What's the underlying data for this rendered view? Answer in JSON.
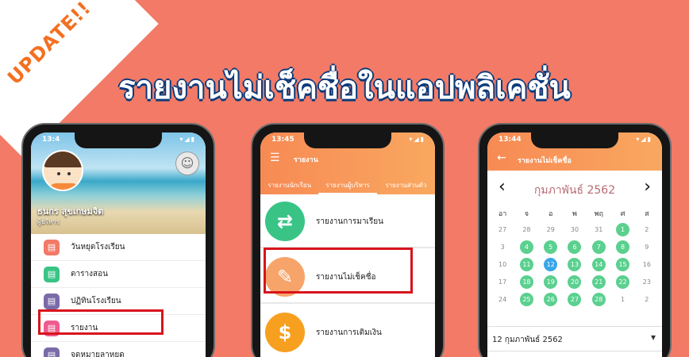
{
  "badge": "UPDATE!!",
  "headline": "รายงานไม่เช็คชื่อในแอปพลิเคชั่น",
  "phone1": {
    "time": "13:4",
    "user_name": "ธนกร สุขเกษมจิต",
    "user_role": "ผู้บริหาร",
    "menu": [
      {
        "label": "วันหยุดโรงเรียน",
        "color": "#f27a66",
        "icon": "calendar-icon"
      },
      {
        "label": "ตารางสอน",
        "color": "#39c486",
        "icon": "schedule-icon"
      },
      {
        "label": "ปฏิทินโรงเรียน",
        "color": "#7a6aa8",
        "icon": "calendar-icon"
      },
      {
        "label": "รายงาน",
        "color": "#ef5b8f",
        "icon": "chart-icon"
      },
      {
        "label": "จดหมายลาหยุด",
        "color": "#7a6aa8",
        "icon": "letter-icon"
      }
    ]
  },
  "phone2": {
    "time": "13:45",
    "title": "รายงาน",
    "tabs": [
      "รายงานนักเรียน",
      "รายงานผู้บริหาร",
      "รายงานส่วนตัว"
    ],
    "active_tab": 1,
    "rows": [
      {
        "label": "รายงานการมาเรียน",
        "color": "#39c486",
        "glyph": "⇄",
        "icon": "exchange-icon"
      },
      {
        "label": "รายงานไม่เช็คชื่อ",
        "color": "#f7a46a",
        "glyph": "✎",
        "icon": "pencil-icon"
      },
      {
        "label": "รายงานการเติมเงิน",
        "color": "#f7a020",
        "glyph": "$",
        "icon": "dollar-icon"
      }
    ]
  },
  "phone3": {
    "time": "13:44",
    "title": "รายงานไม่เช็คชื่อ",
    "month": "กุมภาพันธ์ 2562",
    "weekdays": [
      "อา",
      "จ",
      "อ",
      "พ",
      "พฤ",
      "ศ",
      "ส"
    ],
    "weeks": [
      [
        {
          "d": "27",
          "s": ""
        },
        {
          "d": "28",
          "s": ""
        },
        {
          "d": "29",
          "s": ""
        },
        {
          "d": "30",
          "s": ""
        },
        {
          "d": "31",
          "s": ""
        },
        {
          "d": "1",
          "s": "on"
        },
        {
          "d": "2",
          "s": ""
        }
      ],
      [
        {
          "d": "3",
          "s": ""
        },
        {
          "d": "4",
          "s": "on"
        },
        {
          "d": "5",
          "s": "on"
        },
        {
          "d": "6",
          "s": "on"
        },
        {
          "d": "7",
          "s": "on"
        },
        {
          "d": "8",
          "s": "on"
        },
        {
          "d": "9",
          "s": ""
        }
      ],
      [
        {
          "d": "10",
          "s": ""
        },
        {
          "d": "11",
          "s": "on"
        },
        {
          "d": "12",
          "s": "today"
        },
        {
          "d": "13",
          "s": "on"
        },
        {
          "d": "14",
          "s": "on"
        },
        {
          "d": "15",
          "s": "on"
        },
        {
          "d": "16",
          "s": ""
        }
      ],
      [
        {
          "d": "17",
          "s": ""
        },
        {
          "d": "18",
          "s": "on"
        },
        {
          "d": "19",
          "s": "on"
        },
        {
          "d": "20",
          "s": "on"
        },
        {
          "d": "21",
          "s": "on"
        },
        {
          "d": "22",
          "s": "on"
        },
        {
          "d": "23",
          "s": ""
        }
      ],
      [
        {
          "d": "24",
          "s": ""
        },
        {
          "d": "25",
          "s": "on"
        },
        {
          "d": "26",
          "s": "on"
        },
        {
          "d": "27",
          "s": "on"
        },
        {
          "d": "28",
          "s": "on"
        },
        {
          "d": "1",
          "s": ""
        },
        {
          "d": "2",
          "s": ""
        }
      ]
    ],
    "selected_date": "12 กุมภาพันธ์ 2562"
  }
}
